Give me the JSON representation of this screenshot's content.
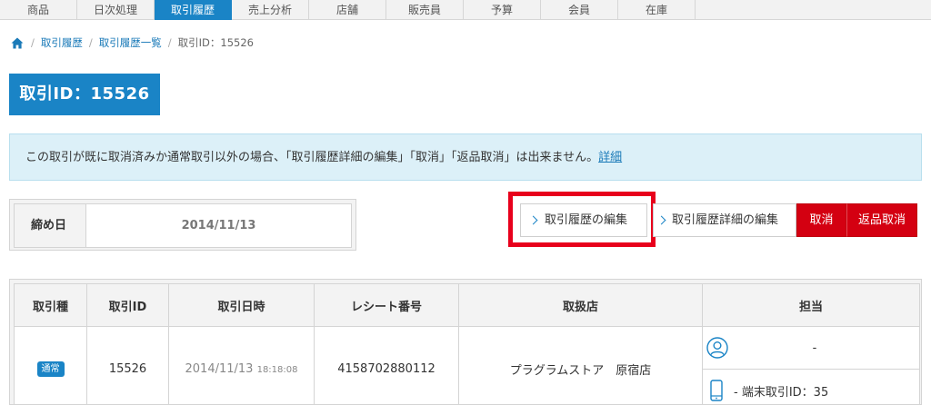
{
  "nav": {
    "tabs": [
      {
        "label": "商品"
      },
      {
        "label": "日次処理"
      },
      {
        "label": "取引履歴"
      },
      {
        "label": "売上分析"
      },
      {
        "label": "店舗"
      },
      {
        "label": "販売員"
      },
      {
        "label": "予算"
      },
      {
        "label": "会員"
      },
      {
        "label": "在庫"
      }
    ],
    "active_tab": "取引履歴"
  },
  "breadcrumb": {
    "items": [
      "取引履歴",
      "取引履歴一覧",
      "取引ID：15526"
    ]
  },
  "page": {
    "title": "取引ID：15526"
  },
  "notice": {
    "text": "この取引が既に取消済みか通常取引以外の場合、「取引履歴詳細の編集」「取消」「返品取消」は出来ません。",
    "link_label": "詳細"
  },
  "close_date": {
    "label": "締め日",
    "value": "2014/11/13"
  },
  "actions": {
    "edit_label": "取引履歴の編集",
    "edit_detail_label": "取引履歴詳細の編集",
    "cancel_label": "取消",
    "return_cancel_label": "返品取消"
  },
  "table": {
    "headers": [
      "取引種",
      "取引ID",
      "取引日時",
      "レシート番号",
      "取扱店",
      "担当"
    ],
    "rows": [
      {
        "type_badge": "通常",
        "transaction_id": "15526",
        "date": "2014/11/13",
        "time": "18:18:08",
        "receipt_no": "4158702880112",
        "store": "プラグラムストア　原宿店",
        "staff": "-",
        "terminal": "-  端末取引ID：35"
      }
    ]
  },
  "colors": {
    "accent": "#1a84c6",
    "danger": "#d40011",
    "highlight": "#e8001c",
    "notice_bg": "#dcf0f8"
  }
}
